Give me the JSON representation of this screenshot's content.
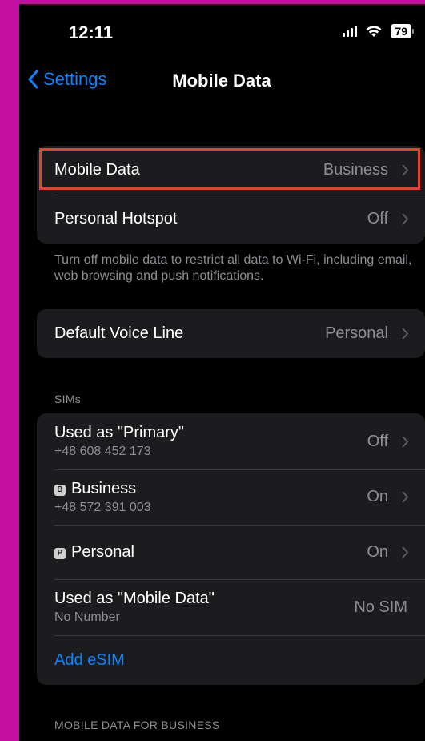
{
  "status": {
    "time": "12:11",
    "battery": "79"
  },
  "nav": {
    "back_label": "Settings",
    "title": "Mobile Data"
  },
  "group1": {
    "rows": [
      {
        "label": "Mobile Data",
        "value": "Business"
      },
      {
        "label": "Personal Hotspot",
        "value": "Off"
      }
    ],
    "footer": "Turn off mobile data to restrict all data to Wi-Fi, including email, web browsing and push notifications."
  },
  "group2": {
    "label": "Default Voice Line",
    "value": "Personal"
  },
  "sims": {
    "header": "SIMs",
    "rows": [
      {
        "label": "Used as \"Primary\"",
        "sub": "+48 608 452 173",
        "value": "Off"
      },
      {
        "badge": "B",
        "label": "Business",
        "sub": "+48 572 391 003",
        "value": "On"
      },
      {
        "badge": "P",
        "label": "Personal",
        "value": "On"
      },
      {
        "label": "Used as \"Mobile Data\"",
        "sub": "No Number",
        "value": "No SIM"
      }
    ],
    "add_label": "Add eSIM"
  },
  "section_business": {
    "header": "MOBILE DATA FOR BUSINESS"
  },
  "colors": {
    "accent": "#0a84ff",
    "highlight": "#e2432a",
    "frame": "#c20fa0"
  }
}
